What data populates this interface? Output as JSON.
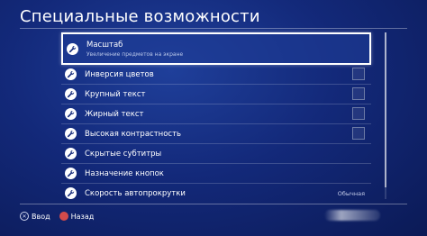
{
  "header": {
    "title": "Специальные возможности"
  },
  "menu": {
    "items": [
      {
        "label": "Масштаб",
        "sublabel": "Увеличение предметов на экране",
        "control": "none"
      },
      {
        "label": "Инверсия цветов",
        "control": "checkbox",
        "checked": false
      },
      {
        "label": "Крупный текст",
        "control": "checkbox",
        "checked": false
      },
      {
        "label": "Жирный текст",
        "control": "checkbox",
        "checked": false
      },
      {
        "label": "Высокая контрастность",
        "control": "checkbox",
        "checked": false
      },
      {
        "label": "Скрытые субтитры",
        "control": "none"
      },
      {
        "label": "Назначение кнопок",
        "control": "none"
      },
      {
        "label": "Скорость автопрокрутки",
        "control": "value",
        "value": "Обычная"
      }
    ]
  },
  "footer": {
    "enter_label": "Ввод",
    "back_label": "Назад"
  },
  "colors": {
    "background": "#13297a",
    "selection_border": "#ffffff"
  },
  "icons": {
    "item_icon": "wrench-icon",
    "enter_icon": "cross-button-icon",
    "back_icon": "circle-button-icon"
  }
}
